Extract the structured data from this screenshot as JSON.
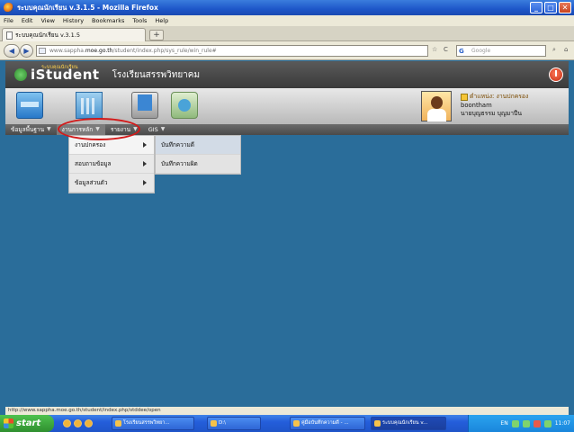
{
  "window": {
    "title": "ระบบคุณนักเรียน v.3.1.5 - Mozilla Firefox",
    "controls": [
      "_",
      "□",
      "✕"
    ]
  },
  "menubar": [
    "File",
    "Edit",
    "View",
    "History",
    "Bookmarks",
    "Tools",
    "Help"
  ],
  "tab": {
    "label": "ระบบคุณนักเรียน v.3.1.5",
    "new_tab": "+"
  },
  "navbar": {
    "back": "◀",
    "forward": "▶",
    "url_prefix": "www.sappha.",
    "url_domain": "moe.go.th",
    "url_rest": "/student/index.php/sys_rule/win_rule#",
    "search_placeholder": "Google",
    "search_engine": "G",
    "star": "☆",
    "reload": "C",
    "search_go": "⌕",
    "home": "⌂"
  },
  "app": {
    "logo_small": "ระบบคุณนักเรียน",
    "logo_text": "iStudent",
    "school_name": "โรงเรียนสรรพวิทยาคม"
  },
  "user": {
    "role": "ตำแหน่ง: งานปกครอง",
    "username": "boontham",
    "fullname": "นายบุญธรรม บุญมาปืน"
  },
  "appmenu": {
    "items": [
      {
        "label": "ข้อมูลพื้นฐาน",
        "arrow": "▼"
      },
      {
        "label": "งานการหลัก",
        "arrow": "▼"
      },
      {
        "label": "รายงาน",
        "arrow": "▼"
      },
      {
        "label": "GIS",
        "arrow": "▼"
      }
    ]
  },
  "dropdown": [
    {
      "label": "งานปกครอง"
    },
    {
      "label": "สอบถามข้อมูล"
    },
    {
      "label": "ข้อมูลส่วนตัว"
    }
  ],
  "submenu": [
    {
      "label": "บันทึกความดี"
    },
    {
      "label": "บันทึกความผิด"
    }
  ],
  "statusbar": {
    "text": "http://www.sappha.moe.go.th/student/index.php/stddee/open"
  },
  "taskbar": {
    "start": "start",
    "tasks": [
      {
        "label": "โรงเรียนสรรพวิทยา..."
      },
      {
        "label": "D:\\"
      },
      {
        "label": "คู่มือบันทึกความดี - ..."
      },
      {
        "label": "ระบบคุณนักเรียน v..."
      }
    ],
    "lang": "EN",
    "clock": "11:07"
  },
  "colors": {
    "page_background": "#2a6d9a",
    "annotation": "#d31919",
    "titlebar": "#1d56c8"
  }
}
